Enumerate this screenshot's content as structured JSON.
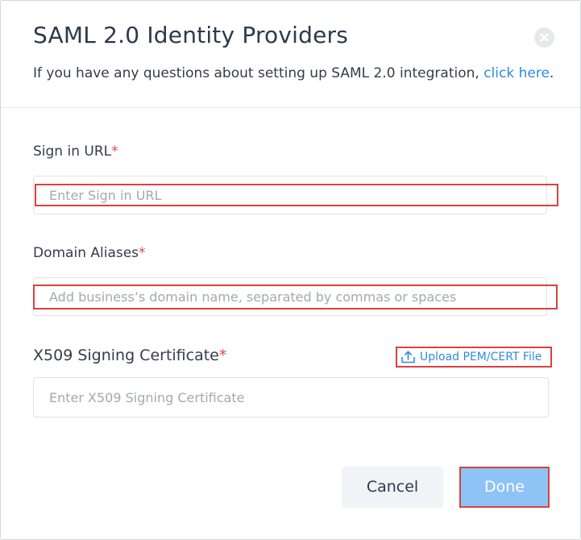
{
  "dialog": {
    "title": "SAML 2.0 Identity Providers",
    "subtitle_prefix": "If you have any questions about setting up SAML 2.0 integration, ",
    "subtitle_link": "click here",
    "subtitle_suffix": ".",
    "close_icon": "close-circle-icon"
  },
  "fields": {
    "sign_in_url": {
      "label": "Sign in URL",
      "required_mark": "*",
      "value": "",
      "placeholder": "Enter Sign in URL"
    },
    "domain_aliases": {
      "label": "Domain Aliases",
      "required_mark": "*",
      "value": "",
      "placeholder": "Add business’s domain name, separated by commas or spaces"
    },
    "x509_cert": {
      "label": "X509 Signing Certificate",
      "required_mark": "*",
      "value": "",
      "placeholder": "Enter X509 Signing Certificate",
      "upload_label": "Upload PEM/CERT File",
      "upload_icon": "upload-icon"
    }
  },
  "footer": {
    "cancel_label": "Cancel",
    "done_label": "Done"
  },
  "colors": {
    "accent_link": "#2f8ae0",
    "required": "#e0474c",
    "highlight": "#d9423f",
    "done_button": "#8ec3f6",
    "cancel_button": "#f1f4f7"
  }
}
